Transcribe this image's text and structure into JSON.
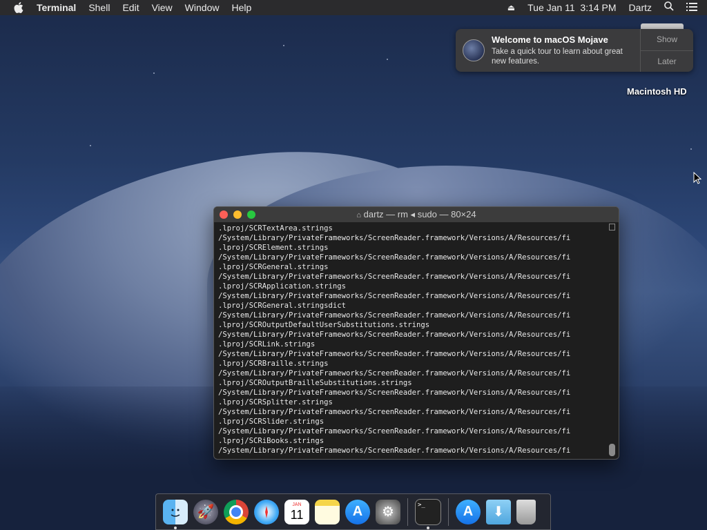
{
  "menubar": {
    "app": "Terminal",
    "items": [
      "Shell",
      "Edit",
      "View",
      "Window",
      "Help"
    ],
    "clock": "Tue Jan 11  3:14 PM",
    "user": "Dartz"
  },
  "notification": {
    "title": "Welcome to macOS Mojave",
    "body": "Take a quick tour to learn about great new features.",
    "show": "Show",
    "later": "Later"
  },
  "desktop": {
    "drive_label": "Macintosh HD"
  },
  "terminal": {
    "title": "dartz — rm ◂ sudo — 80×24",
    "lines": [
      ".lproj/SCRTextArea.strings",
      "/System/Library/PrivateFrameworks/ScreenReader.framework/Versions/A/Resources/fi",
      ".lproj/SCRElement.strings",
      "/System/Library/PrivateFrameworks/ScreenReader.framework/Versions/A/Resources/fi",
      ".lproj/SCRGeneral.strings",
      "/System/Library/PrivateFrameworks/ScreenReader.framework/Versions/A/Resources/fi",
      ".lproj/SCRApplication.strings",
      "/System/Library/PrivateFrameworks/ScreenReader.framework/Versions/A/Resources/fi",
      ".lproj/SCRGeneral.stringsdict",
      "/System/Library/PrivateFrameworks/ScreenReader.framework/Versions/A/Resources/fi",
      ".lproj/SCROutputDefaultUserSubstitutions.strings",
      "/System/Library/PrivateFrameworks/ScreenReader.framework/Versions/A/Resources/fi",
      ".lproj/SCRLink.strings",
      "/System/Library/PrivateFrameworks/ScreenReader.framework/Versions/A/Resources/fi",
      ".lproj/SCRBraille.strings",
      "/System/Library/PrivateFrameworks/ScreenReader.framework/Versions/A/Resources/fi",
      ".lproj/SCROutputBrailleSubstitutions.strings",
      "/System/Library/PrivateFrameworks/ScreenReader.framework/Versions/A/Resources/fi",
      ".lproj/SCRSplitter.strings",
      "/System/Library/PrivateFrameworks/ScreenReader.framework/Versions/A/Resources/fi",
      ".lproj/SCRSlider.strings",
      "/System/Library/PrivateFrameworks/ScreenReader.framework/Versions/A/Resources/fi",
      ".lproj/SCRiBooks.strings",
      "/System/Library/PrivateFrameworks/ScreenReader.framework/Versions/A/Resources/fi"
    ]
  },
  "dock": {
    "calendar_month": "JAN",
    "calendar_day": "11",
    "terminal_prompt": ">_",
    "items": [
      "finder-icon",
      "launchpad-icon",
      "chrome-icon",
      "safari-icon",
      "calendar-icon",
      "notes-icon",
      "app-store-icon",
      "system-preferences-icon",
      "terminal-icon",
      "applications-folder-icon",
      "downloads-folder-icon",
      "trash-icon"
    ]
  }
}
